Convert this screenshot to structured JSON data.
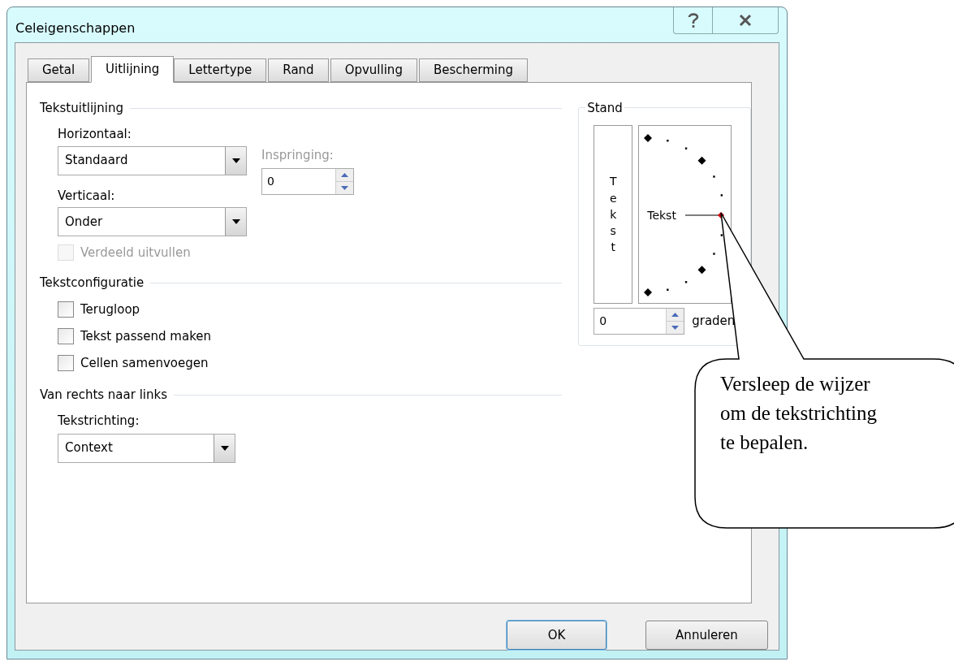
{
  "window": {
    "title": "Celeigenschappen"
  },
  "tabs": [
    {
      "label": "Getal",
      "selected": false
    },
    {
      "label": "Uitlijning",
      "selected": true
    },
    {
      "label": "Lettertype",
      "selected": false
    },
    {
      "label": "Rand",
      "selected": false
    },
    {
      "label": "Opvulling",
      "selected": false
    },
    {
      "label": "Bescherming",
      "selected": false
    }
  ],
  "text_alignment": {
    "title": "Tekstuitlijning",
    "horizontal": {
      "label": "Horizontaal:",
      "value": "Standaard"
    },
    "indent": {
      "label": "Inspringing:",
      "value": "0",
      "disabled": true
    },
    "vertical": {
      "label": "Verticaal:",
      "value": "Onder"
    },
    "distributed": {
      "label": "Verdeeld uitvullen",
      "checked": false,
      "disabled": true
    }
  },
  "text_control": {
    "title": "Tekstconfiguratie",
    "options": [
      {
        "label": "Terugloop",
        "checked": false,
        "disabled": false
      },
      {
        "label": "Tekst passend maken",
        "checked": false,
        "disabled": false
      },
      {
        "label": "Cellen samenvoegen",
        "checked": false,
        "disabled": false
      }
    ]
  },
  "right_to_left": {
    "title": "Van rechts naar links",
    "direction": {
      "label": "Tekstrichting:",
      "value": "Context"
    }
  },
  "orientation": {
    "title": "Stand",
    "vertical_text": "Tekst",
    "dial_text": "Tekst",
    "degrees": {
      "value": "0",
      "unit": "graden"
    }
  },
  "buttons": [
    {
      "label": "OK",
      "default": true
    },
    {
      "label": "Annuleren",
      "default": false
    }
  ],
  "callout": {
    "text": "Versleep de wijzer om de tekstrichting te bepalen."
  }
}
